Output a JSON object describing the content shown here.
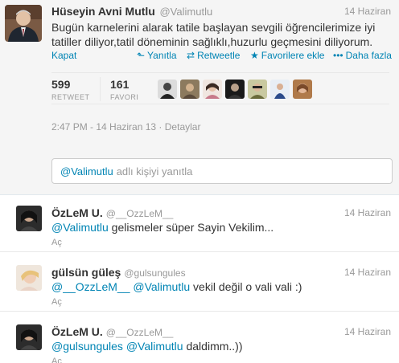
{
  "tweet": {
    "fullname": "Hüseyin Avni Mutlu",
    "screenname": "@Valimutlu",
    "time": "14 Haziran",
    "text": "Bugün karnelerini alarak tatile başlayan sevgili öğrencilerimize iyi tatiller diliyor,tatil döneminin sağlıklı,huzurlu  geçmesini diliyorum.",
    "close_label": "Kapat",
    "reply_label": "Yanıtla",
    "retweet_label": "Retweetle",
    "favorite_label": "Favorilere ekle",
    "more_label": "Daha fazla",
    "retweet_count": "599",
    "retweet_caption": "RETWEET",
    "favorite_count": "161",
    "favorite_caption": "FAVORI",
    "timestamp": "2:47 PM - 14 Haziran 13",
    "details_label": "Detaylar",
    "meta_sep": "·"
  },
  "reply_box": {
    "mention": "@Valimutlu",
    "placeholder": "adlı kişiyi yanıtla"
  },
  "replies": [
    {
      "fullname": "ÖzLeM U.",
      "screenname": "@__OzzLeM__",
      "time": "14 Haziran",
      "mentions": [
        "@Valimutlu"
      ],
      "text": "gelismeler süper Sayin Vekilim...",
      "action": "Aç"
    },
    {
      "fullname": "gülsün güleş",
      "screenname": "@gulsungules",
      "time": "14 Haziran",
      "mentions": [
        "@__OzzLeM__",
        "@Valimutlu"
      ],
      "text": "vekil değil o vali vali :)",
      "action": "Aç"
    },
    {
      "fullname": "ÖzLeM U.",
      "screenname": "@__OzzLeM__",
      "time": "14 Haziran",
      "mentions": [
        "@gulsungules",
        "@Valimutlu"
      ],
      "text": "daldimm..))",
      "action": "Aç"
    }
  ],
  "icons": {
    "reply": "reply-arrow-icon",
    "retweet": "retweet-icon",
    "favorite": "star-icon",
    "more": "more-dots-icon"
  },
  "colors": {
    "link": "#0084b4",
    "muted": "#999999",
    "text": "#333333",
    "expanded_bg": "#f5f5f5"
  }
}
